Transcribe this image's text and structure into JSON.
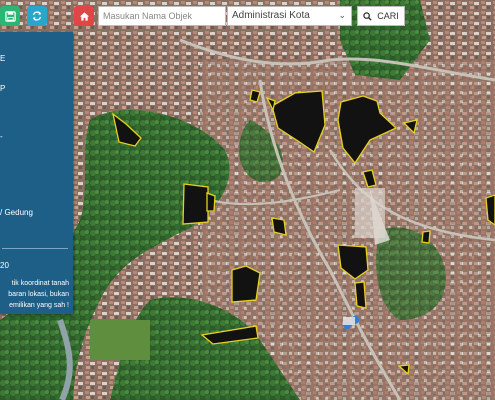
{
  "toolbar": {
    "home_icon": "home-icon",
    "save_icon": "save-icon",
    "refresh_icon": "refresh-icon",
    "search_placeholder": "Masukan Nama Objek",
    "search_value": "",
    "admin_select_value": "Administrasi Kota",
    "search_button_label": "CARI",
    "search_icon": "search-icon"
  },
  "panel": {
    "items": [
      {
        "label": "E"
      },
      {
        "label": "P"
      },
      {
        "label": "-"
      },
      {
        "label": "/ Gedung"
      },
      {
        "label": "20"
      }
    ],
    "note_lines": [
      "tik koordinat tanah",
      "baran lokasi, bukan",
      "emilikan yang sah !"
    ]
  },
  "colors": {
    "panel_bg": "#1d5f86",
    "green_button": "#2bb673",
    "cyan_button": "#2aa6cc",
    "red_button": "#e14545",
    "polygon_outline": "#e8d21f"
  }
}
